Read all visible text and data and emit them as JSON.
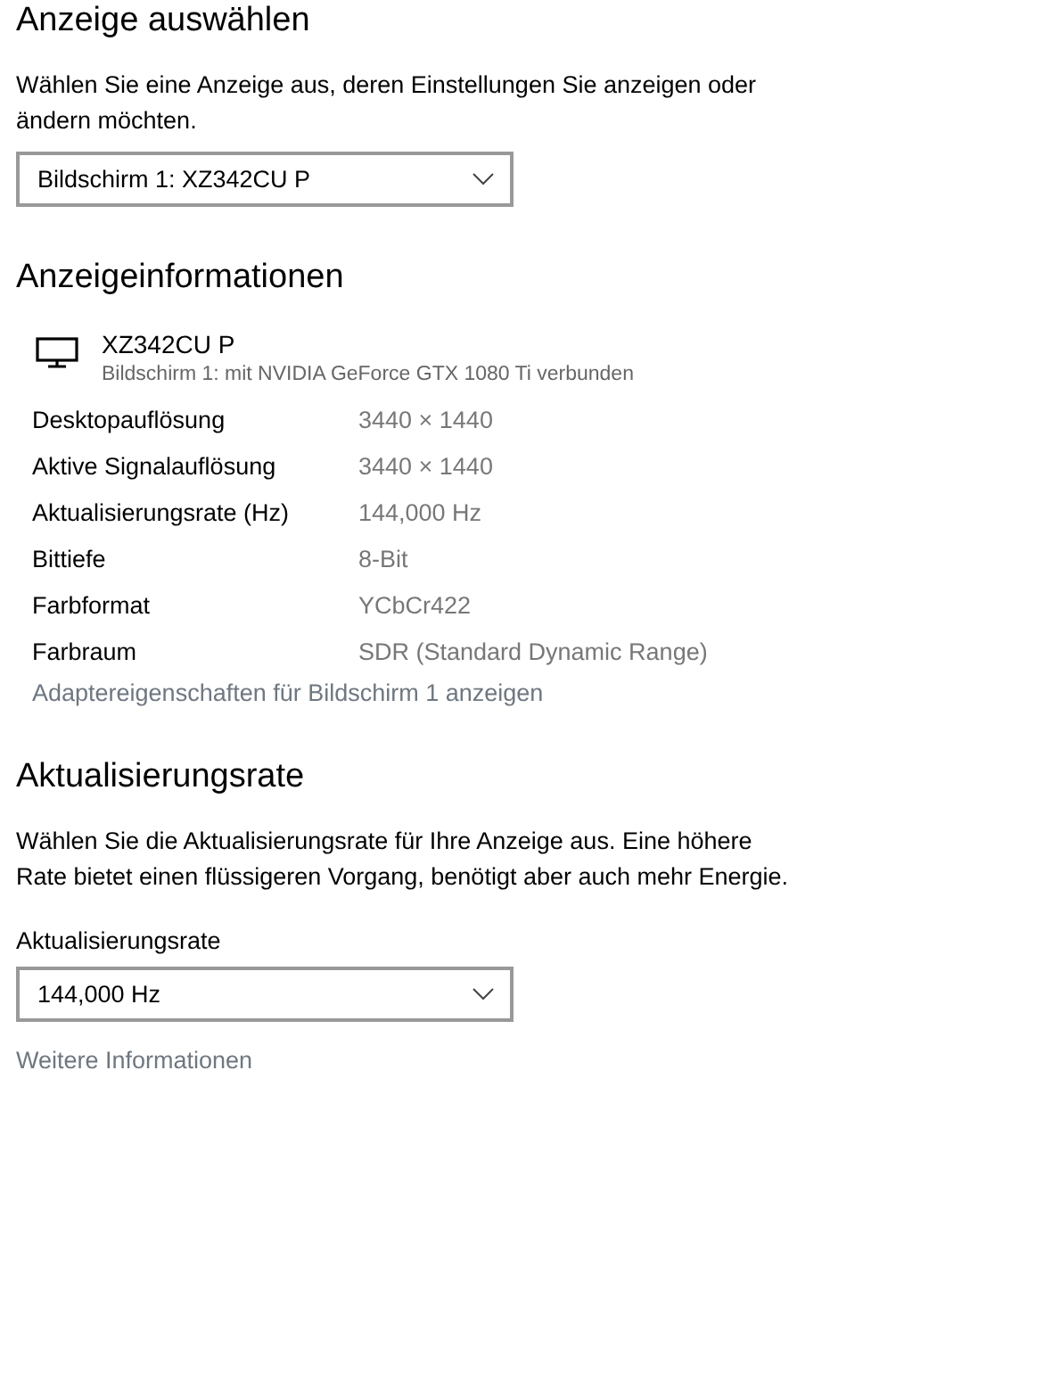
{
  "select_display": {
    "title": "Anzeige auswählen",
    "description": "Wählen Sie eine Anzeige aus, deren Einstellungen Sie anzeigen oder ändern möchten.",
    "dropdown": {
      "value": "Bildschirm 1: XZ342CU P"
    }
  },
  "display_info": {
    "title": "Anzeigeinformationen",
    "monitor_name": "XZ342CU P",
    "monitor_subtitle": "Bildschirm 1: mit NVIDIA GeForce GTX 1080 Ti verbunden",
    "rows": [
      {
        "label": "Desktopauflösung",
        "value": "3440 × 1440"
      },
      {
        "label": "Aktive Signalauflösung",
        "value": "3440 × 1440"
      },
      {
        "label": "Aktualisierungsrate (Hz)",
        "value": "144,000 Hz"
      },
      {
        "label": "Bittiefe",
        "value": "8-Bit"
      },
      {
        "label": "Farbformat",
        "value": "YCbCr422"
      },
      {
        "label": "Farbraum",
        "value": "SDR (Standard Dynamic Range)"
      }
    ],
    "link": "Adaptereigenschaften für Bildschirm 1 anzeigen"
  },
  "refresh_rate": {
    "title": "Aktualisierungsrate",
    "description": "Wählen Sie die Aktualisierungsrate für Ihre Anzeige aus. Eine höhere Rate bietet einen flüssigeren Vorgang, benötigt aber auch mehr Energie.",
    "field_label": "Aktualisierungsrate",
    "dropdown": {
      "value": "144,000 Hz"
    },
    "link": "Weitere Informationen"
  }
}
